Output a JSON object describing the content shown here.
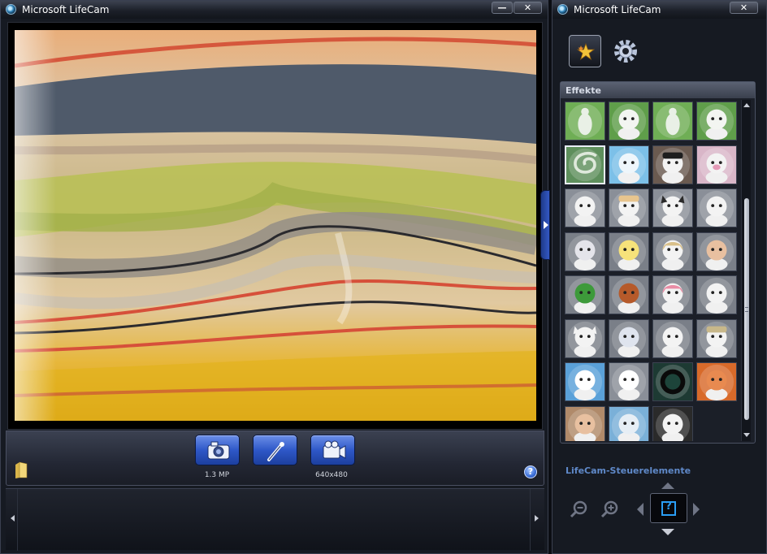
{
  "main_window": {
    "title": "Microsoft LifeCam",
    "minimize_label": "—",
    "close_label": "✕"
  },
  "capture_toolbar": {
    "buttons": [
      {
        "name": "photo",
        "icon": "camera-icon"
      },
      {
        "name": "effects",
        "icon": "magic-wand-icon"
      },
      {
        "name": "video",
        "icon": "video-camera-icon"
      }
    ],
    "photo_resolution": "1.3 MP",
    "video_resolution": "640x480",
    "folder_icon": "folder-icon",
    "help_label": "?"
  },
  "side_panel": {
    "title": "Microsoft LifeCam",
    "close_label": "✕",
    "modes": [
      {
        "name": "effects",
        "icon": "effects-star-icon",
        "active": true
      },
      {
        "name": "settings",
        "icon": "gear-icon",
        "active": false
      }
    ],
    "effects_title": "Effekte",
    "controls_title": "LifeCam-Steuerelemente",
    "selected_effect": 4
  },
  "colors": {
    "accent_blue": "#2f58c8",
    "panel_dark": "#161a22",
    "header_text": "#5f89c9"
  }
}
